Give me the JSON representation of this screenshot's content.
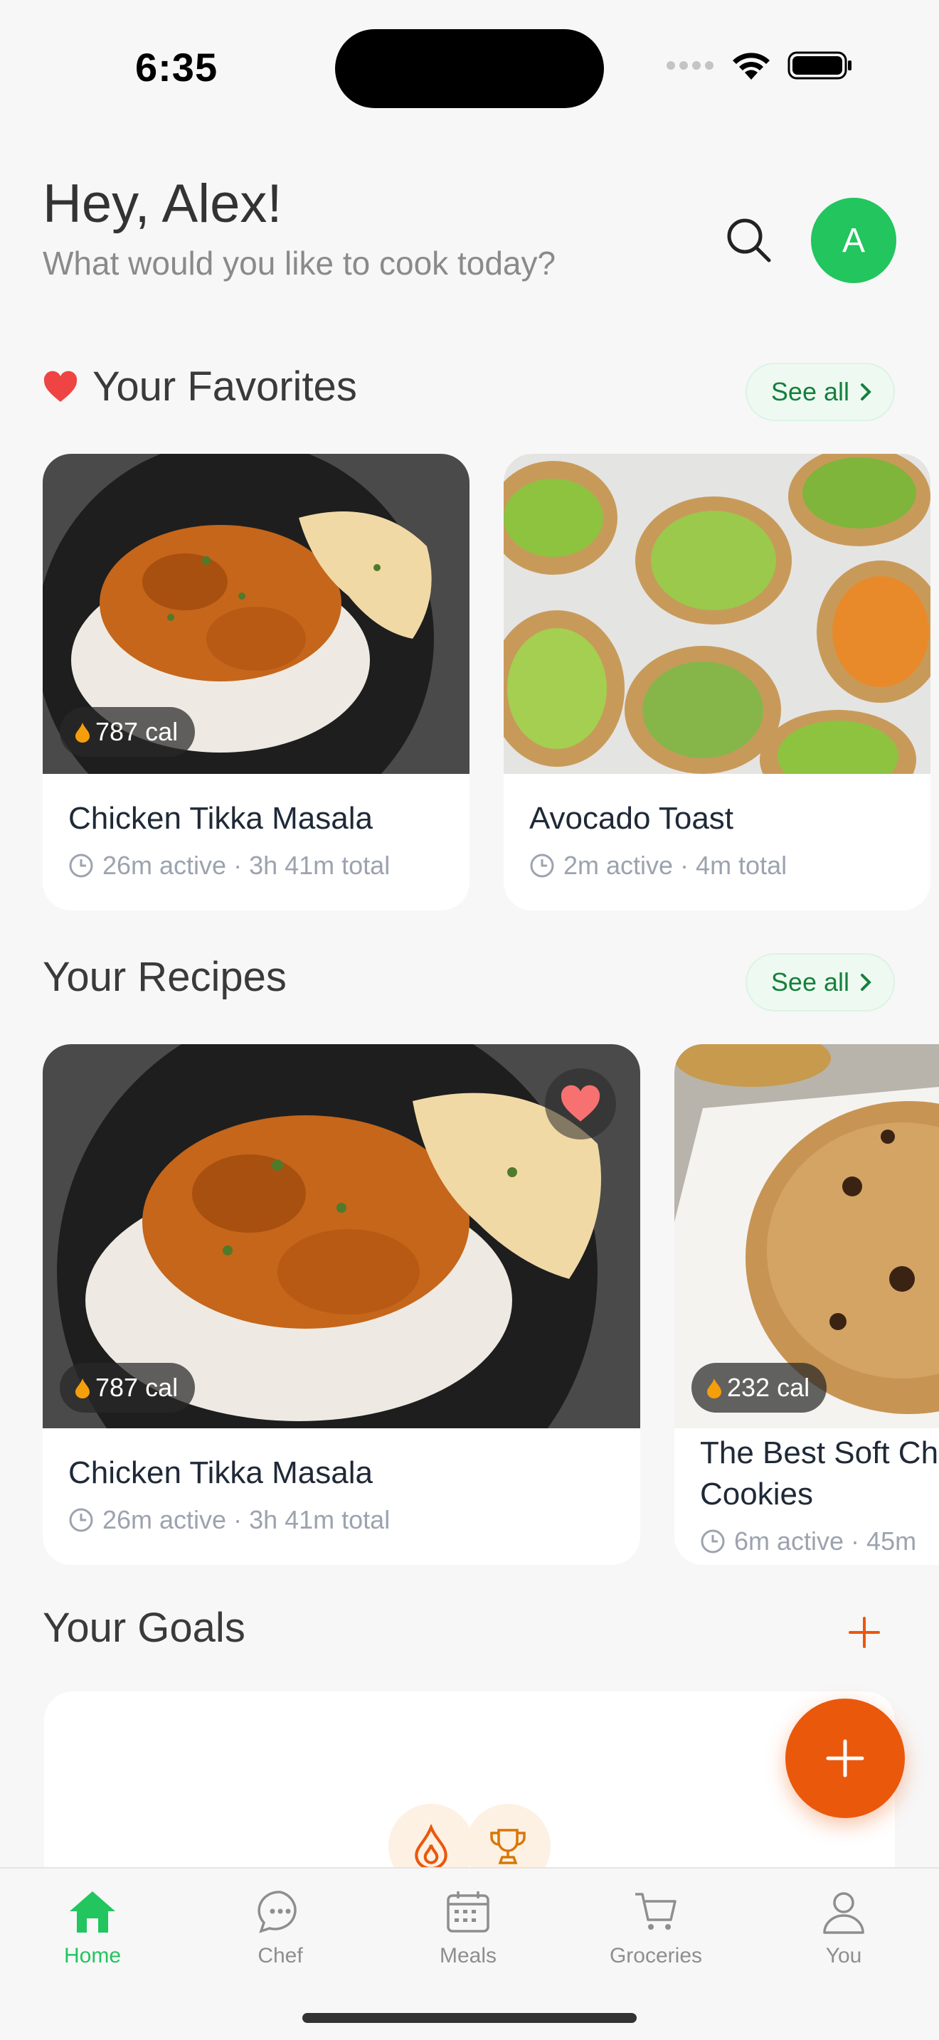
{
  "status": {
    "time": "6:35"
  },
  "header": {
    "greeting": "Hey, Alex!",
    "subtitle": "What would you like to cook today?",
    "avatar_initial": "A"
  },
  "favorites": {
    "title": "Your Favorites",
    "see_all": "See all",
    "items": [
      {
        "title": "Chicken Tikka Masala",
        "calories": "787 cal",
        "time": "26m active · 3h 41m total"
      },
      {
        "title": "Avocado Toast",
        "time": "2m active · 4m total"
      }
    ]
  },
  "recipes": {
    "title": "Your Recipes",
    "see_all": "See all",
    "items": [
      {
        "title": "Chicken Tikka Masala",
        "calories": "787 cal",
        "time": "26m active · 3h 41m total"
      },
      {
        "title_line1": "The Best Soft Ch",
        "title_line2": "Cookies",
        "calories": "232 cal",
        "time": "6m active · 45m"
      }
    ]
  },
  "goals": {
    "title": "Your Goals"
  },
  "tabs": [
    {
      "label": "Home",
      "icon": "home-icon"
    },
    {
      "label": "Chef",
      "icon": "chat-bubble-icon"
    },
    {
      "label": "Meals",
      "icon": "calendar-icon"
    },
    {
      "label": "Groceries",
      "icon": "cart-icon"
    },
    {
      "label": "You",
      "icon": "person-icon"
    }
  ],
  "colors": {
    "accent_green": "#22c55e",
    "accent_orange": "#ea580c",
    "heart_red": "#ef4444"
  }
}
